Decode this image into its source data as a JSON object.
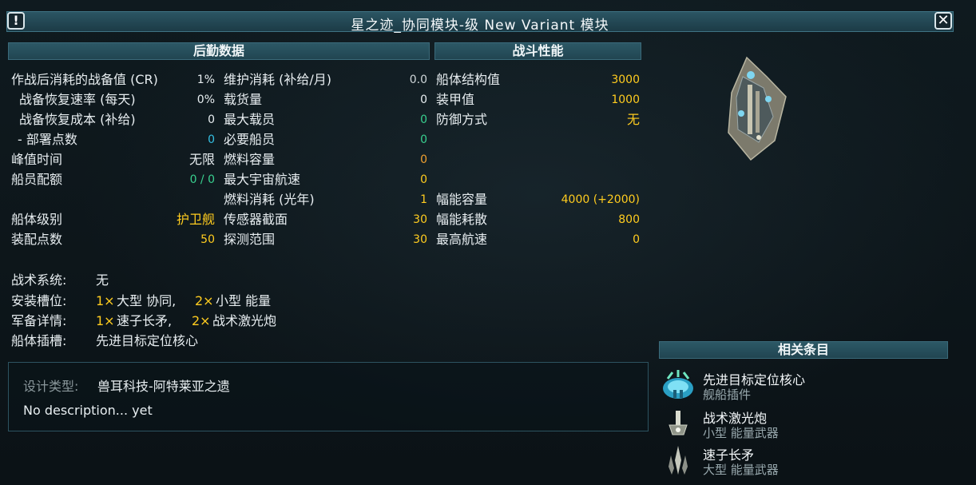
{
  "window": {
    "title": "星之迹_协同模块-级 New Variant 模块",
    "info_icon": "!",
    "close_icon": "✕"
  },
  "logistics": {
    "header": "后勤数据",
    "col1": [
      {
        "label": "作战后消耗的战备值 (CR)",
        "value": "1%"
      },
      {
        "label": "战备恢复速率 (每天)",
        "value": "0%"
      },
      {
        "label": "战备恢复成本 (补给)",
        "value": "0"
      },
      {
        "label": "- 部署点数",
        "value": "0"
      },
      {
        "label": "峰值时间",
        "value": "无限"
      },
      {
        "label": "船员配额",
        "value": "0 / 0"
      },
      {
        "label": "船体级别",
        "value": "护卫舰"
      },
      {
        "label": "装配点数",
        "value": "50"
      }
    ],
    "col2": [
      {
        "label": "维护消耗 (补给/月)",
        "value": "0.0"
      },
      {
        "label": "载货量",
        "value": "0"
      },
      {
        "label": "最大载员",
        "value": "0"
      },
      {
        "label": "必要船员",
        "value": "0"
      },
      {
        "label": "燃料容量",
        "value": "0"
      },
      {
        "label": "最大宇宙航速",
        "value": "0"
      },
      {
        "label": "燃料消耗 (光年)",
        "value": "1"
      },
      {
        "label": "传感器截面",
        "value": "30"
      },
      {
        "label": "探测范围",
        "value": "30"
      }
    ]
  },
  "combat": {
    "header": "战斗性能",
    "rows": [
      {
        "label": "船体结构值",
        "value": "3000"
      },
      {
        "label": "装甲值",
        "value": "1000"
      },
      {
        "label": "防御方式",
        "value": "无"
      },
      {
        "label": "幅能容量",
        "value": "4000 (+2000)"
      },
      {
        "label": "幅能耗散",
        "value": "800"
      },
      {
        "label": "最高航速",
        "value": "0"
      }
    ]
  },
  "details": {
    "tactical_label": "战术系统:",
    "tactical_value": "无",
    "slots_label": "安装槽位:",
    "slots_n1": "1×",
    "slots_t1": "大型 协同,",
    "slots_n2": "2×",
    "slots_t2": "小型 能量",
    "armament_label": "军备详情:",
    "arm_n1": "1×",
    "arm_t1": "速子长矛,",
    "arm_n2": "2×",
    "arm_t2": "战术激光炮",
    "hullmod_label": "船体插槽:",
    "hullmod_value": "先进目标定位核心"
  },
  "description": {
    "design_label": "设计类型:",
    "design_value": "兽耳科技-阿特莱亚之遗",
    "text": "No description... yet"
  },
  "related": {
    "header": "相关条目",
    "items": [
      {
        "title": "先进目标定位核心",
        "subtitle": "舰船插件",
        "icon": "targeting-core-icon"
      },
      {
        "title": "战术激光炮",
        "subtitle": "小型 能量武器",
        "icon": "tactical-laser-icon"
      },
      {
        "title": "速子长矛",
        "subtitle": "大型 能量武器",
        "icon": "tachyon-lance-icon"
      }
    ]
  },
  "colors": {
    "header_bg": "#2c5866",
    "yellow": "#ffcc1f",
    "green": "#39d08f",
    "cyan": "#35c0e2",
    "orange": "#f0a130"
  }
}
